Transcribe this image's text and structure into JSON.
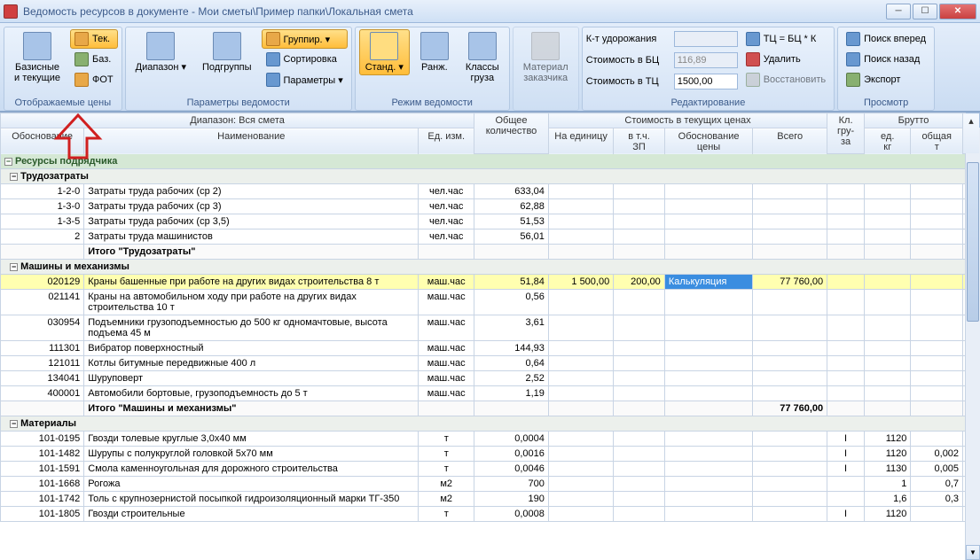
{
  "window": {
    "title": "Ведомость ресурсов в документе - Мои сметы\\Пример папки\\Локальная смета"
  },
  "ribbon": {
    "groups": {
      "prices": {
        "label": "Отображаемые цены",
        "basic_current": "Базисные\nи текущие",
        "tek": "Тек.",
        "baz": "Баз.",
        "fot": "ФОТ"
      },
      "params": {
        "label": "Параметры ведомости",
        "range": "Диапазон",
        "subgroups": "Подгруппы",
        "group": "Группир.",
        "sort": "Сортировка",
        "opts": "Параметры"
      },
      "mode": {
        "label": "Режим ведомости",
        "standard": "Станд.",
        "rank": "Ранж.",
        "cargo_classes": "Классы\nгруза"
      },
      "customer": {
        "label": "",
        "material": "Материал\nзаказчика"
      },
      "edit": {
        "label": "Редактирование",
        "k_markup": "К-т удорожания",
        "cost_bc_lbl": "Стоимость в БЦ",
        "cost_bc_val": "116,89",
        "cost_tc_lbl": "Стоимость в ТЦ",
        "cost_tc_val": "1500,00",
        "formula": "ТЦ = БЦ * К",
        "delete": "Удалить",
        "restore": "Восстановить"
      },
      "view": {
        "label": "Просмотр",
        "search_fwd": "Поиск вперед",
        "search_back": "Поиск назад",
        "export": "Экспорт"
      }
    }
  },
  "grid": {
    "headers": {
      "range_label": "Диапазон: Вся смета",
      "code": "Обоснование",
      "name": "Наименование",
      "unit": "Ед. изм.",
      "qty": "Общее\nколичество",
      "current_prices": "Стоимость в текущих ценах",
      "per_unit": "На единицу",
      "incl_zp": "в т.ч.\nЗП",
      "basis": "Обоснование\nцены",
      "total": "Всего",
      "kl": "Кл.\nгру-\nза",
      "gross": "Брутто",
      "g1": "ед.\nкг",
      "g2": "общая\nт"
    },
    "groups": [
      {
        "type": "group",
        "name": "Ресурсы подрядчика"
      },
      {
        "type": "subgroup",
        "name": "Трудозатраты"
      }
    ],
    "rows_labor": [
      {
        "code": "1-2-0",
        "name": "Затраты труда рабочих (ср 2)",
        "unit": "чел.час",
        "qty": "633,04"
      },
      {
        "code": "1-3-0",
        "name": "Затраты труда рабочих (ср 3)",
        "unit": "чел.час",
        "qty": "62,88"
      },
      {
        "code": "1-3-5",
        "name": "Затраты труда рабочих (ср 3,5)",
        "unit": "чел.час",
        "qty": "51,53"
      },
      {
        "code": "2",
        "name": "Затраты труда машинистов",
        "unit": "чел.час",
        "qty": "56,01"
      }
    ],
    "total_labor": "Итого \"Трудозатраты\"",
    "subgroup_machines": "Машины и механизмы",
    "rows_machines": [
      {
        "code": "020129",
        "name": "Краны башенные при работе на других видах строительства 8 т",
        "unit": "маш.час",
        "qty": "51,84",
        "per_unit": "1 500,00",
        "zp": "200,00",
        "basis": "Калькуляция",
        "total": "77 760,00",
        "hl": true
      },
      {
        "code": "021141",
        "name": "Краны на автомобильном ходу при работе на других видах строительства 10 т",
        "unit": "маш.час",
        "qty": "0,56"
      },
      {
        "code": "030954",
        "name": "Подъемники грузоподъемностью до 500 кг одномачтовые, высота подъема 45 м",
        "unit": "маш.час",
        "qty": "3,61"
      },
      {
        "code": "111301",
        "name": "Вибратор поверхностный",
        "unit": "маш.час",
        "qty": "144,93"
      },
      {
        "code": "121011",
        "name": "Котлы битумные передвижные 400 л",
        "unit": "маш.час",
        "qty": "0,64"
      },
      {
        "code": "134041",
        "name": "Шуруповерт",
        "unit": "маш.час",
        "qty": "2,52"
      },
      {
        "code": "400001",
        "name": "Автомобили бортовые, грузоподъемность до 5 т",
        "unit": "маш.час",
        "qty": "1,19"
      }
    ],
    "total_machines": {
      "label": "Итого \"Машины и механизмы\"",
      "total": "77 760,00"
    },
    "subgroup_materials": "Материалы",
    "rows_materials": [
      {
        "code": "101-0195",
        "name": "Гвозди толевые круглые 3,0х40 мм",
        "unit": "т",
        "qty": "0,0004",
        "kl": "I",
        "g1": "1120"
      },
      {
        "code": "101-1482",
        "name": "Шурупы с полукруглой головкой 5х70 мм",
        "unit": "т",
        "qty": "0,0016",
        "kl": "I",
        "g1": "1120",
        "g2": "0,002"
      },
      {
        "code": "101-1591",
        "name": "Смола каменноугольная для дорожного строительства",
        "unit": "т",
        "qty": "0,0046",
        "kl": "I",
        "g1": "1130",
        "g2": "0,005"
      },
      {
        "code": "101-1668",
        "name": "Рогожа",
        "unit": "м2",
        "qty": "700",
        "g1": "1",
        "g2": "0,7"
      },
      {
        "code": "101-1742",
        "name": "Толь с крупнозернистой посыпкой гидроизоляционный марки ТГ-350",
        "unit": "м2",
        "qty": "190",
        "g1": "1,6",
        "g2": "0,3"
      },
      {
        "code": "101-1805",
        "name": "Гвозди строительные",
        "unit": "т",
        "qty": "0,0008",
        "kl": "I",
        "g1": "1120"
      }
    ]
  }
}
